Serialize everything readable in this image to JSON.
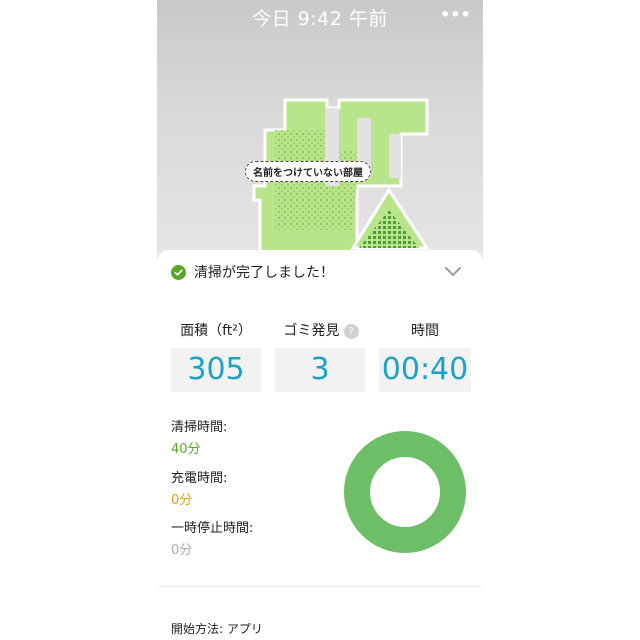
{
  "status_bar": {
    "time": "今日 9:42 午前",
    "menu_icon": "more-dots-icon"
  },
  "map": {
    "room_label": "名前をつけていない部屋",
    "room_color": "#b9e58a"
  },
  "summary": {
    "title": "清掃が完了しました！",
    "check_color": "#5aa62a",
    "collapse_icon": "chevron-down-icon"
  },
  "stats": {
    "area_label": "面積（ft²）",
    "area_value": "305",
    "dirt_label": "ゴミ発見",
    "dirt_value": "3",
    "help_glyph": "?",
    "time_label": "時間",
    "time_value": "00:40",
    "value_color": "#1aa3c8"
  },
  "times": {
    "clean_label": "清掃時間:",
    "clean_value": "40分",
    "clean_color": "#5aa62a",
    "charge_label": "充電時間:",
    "charge_value": "0分",
    "charge_color": "#e5a400",
    "pause_label": "一時停止時間:",
    "pause_value": "0分",
    "pause_color": "#aaaaaa"
  },
  "donut": {
    "color": "#6cbf66"
  },
  "footer": {
    "start_method": "開始方法: アプリ"
  }
}
